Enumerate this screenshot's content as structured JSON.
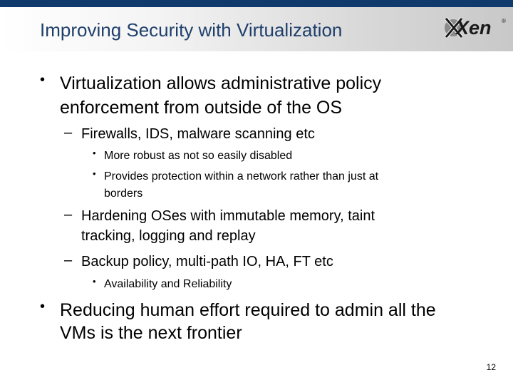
{
  "slide": {
    "title": "Improving Security with Virtualization",
    "logo_text": "Xen",
    "logo_mark": "®",
    "page_number": "12",
    "bullet_marks": {
      "level1": "•",
      "level2": "–",
      "level3": "•"
    },
    "bullets": [
      {
        "lines": [
          "Virtualization allows administrative policy",
          "enforcement from outside of the OS"
        ],
        "children": [
          {
            "lines": [
              "Firewalls, IDS, malware scanning etc"
            ],
            "children": [
              {
                "lines": [
                  "More robust as not so easily disabled"
                ]
              },
              {
                "lines": [
                  "Provides protection within a network rather than just at",
                  "borders"
                ]
              }
            ]
          },
          {
            "lines": [
              "Hardening OSes with immutable memory, taint",
              "tracking, logging and replay"
            ]
          },
          {
            "lines": [
              "Backup policy, multi-path IO, HA, FT etc"
            ],
            "children": [
              {
                "lines": [
                  "Availability and Reliability"
                ]
              }
            ]
          }
        ]
      },
      {
        "lines": [
          "Reducing human effort required to admin all the",
          "VMs is the next frontier"
        ]
      }
    ]
  }
}
